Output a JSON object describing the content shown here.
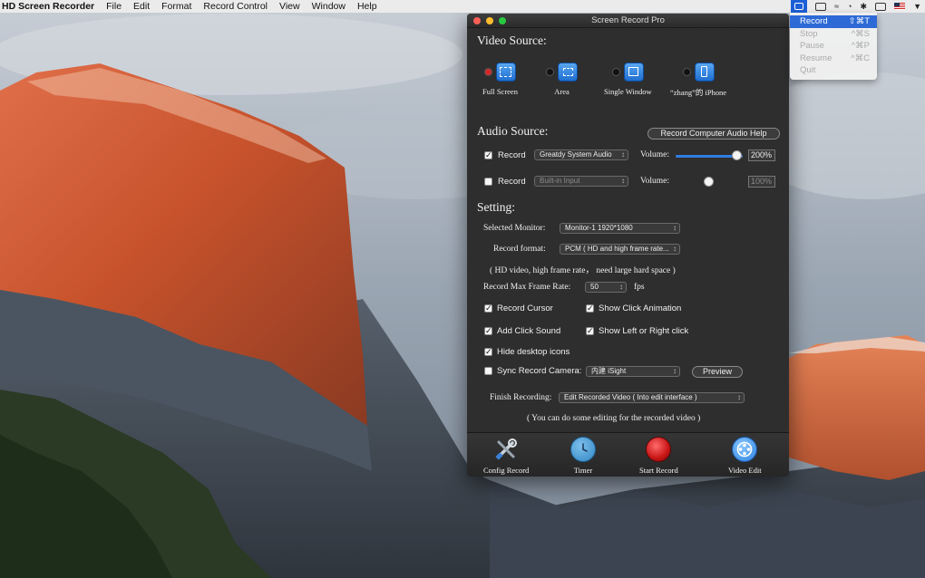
{
  "menubar": {
    "app_name": "HD Screen Recorder",
    "items": [
      "File",
      "Edit",
      "Format",
      "Record Control",
      "View",
      "Window",
      "Help"
    ]
  },
  "status_menu": {
    "items": [
      {
        "label": "Record",
        "shortcut": "⇧⌘T",
        "enabled": true
      },
      {
        "label": "Stop",
        "shortcut": "^⌘S",
        "enabled": false
      },
      {
        "label": "Pause",
        "shortcut": "^⌘P",
        "enabled": false
      },
      {
        "label": "Resume",
        "shortcut": "^⌘C",
        "enabled": false
      },
      {
        "label": "Quit",
        "shortcut": "",
        "enabled": false
      }
    ]
  },
  "window": {
    "title": "Screen Record Pro",
    "video_source": {
      "heading": "Video Source:",
      "options": [
        "Full Screen",
        "Area",
        "Single Window",
        "“zhang”的 iPhone"
      ],
      "selected_index": 0
    },
    "audio_source": {
      "heading": "Audio Source:",
      "help_button": "Record Computer Audio Help",
      "rows": [
        {
          "checked": true,
          "label": "Record",
          "device": "Greatdy System Audio",
          "volume_label": "Volume:",
          "volume_value": "200%",
          "volume_level": 1.0
        },
        {
          "checked": false,
          "label": "Record",
          "device": "Built-in Input",
          "volume_label": "Volume:",
          "volume_value": "100%",
          "volume_level": 0.5
        }
      ]
    },
    "setting": {
      "heading": "Setting:",
      "monitor_label": "Selected Monitor:",
      "monitor_value": "Monitor-1 1920*1080",
      "format_label": "Record format:",
      "format_value": "PCM ( HD and high frame rate...",
      "format_note": "( HD video, high frame rate， need large hard space )",
      "frame_rate_label": "Record Max Frame Rate:",
      "frame_rate_value": "50",
      "frame_rate_unit": "fps",
      "options": [
        {
          "label": "Record Cursor",
          "checked": true
        },
        {
          "label": "Show Click Animation",
          "checked": true
        },
        {
          "label": "Add Click Sound",
          "checked": true
        },
        {
          "label": "Show Left or Right click",
          "checked": true
        },
        {
          "label": "Hide desktop icons",
          "checked": true
        }
      ],
      "camera_label": "Sync Record Camera:",
      "camera_checked": false,
      "camera_value": "内建 iSight",
      "preview_button": "Preview",
      "finish_label": "Finish Recording:",
      "finish_value": "Edit Recorded Video ( Into edit interface )",
      "finish_note": "( You can do some editing for the recorded video )"
    },
    "toolbar": [
      {
        "label": "Config Record",
        "icon": "tools-icon"
      },
      {
        "label": "Timer",
        "icon": "clock-icon"
      },
      {
        "label": "Start Record",
        "icon": "record-icon"
      },
      {
        "label": "Video Edit",
        "icon": "film-reel-icon"
      }
    ]
  }
}
